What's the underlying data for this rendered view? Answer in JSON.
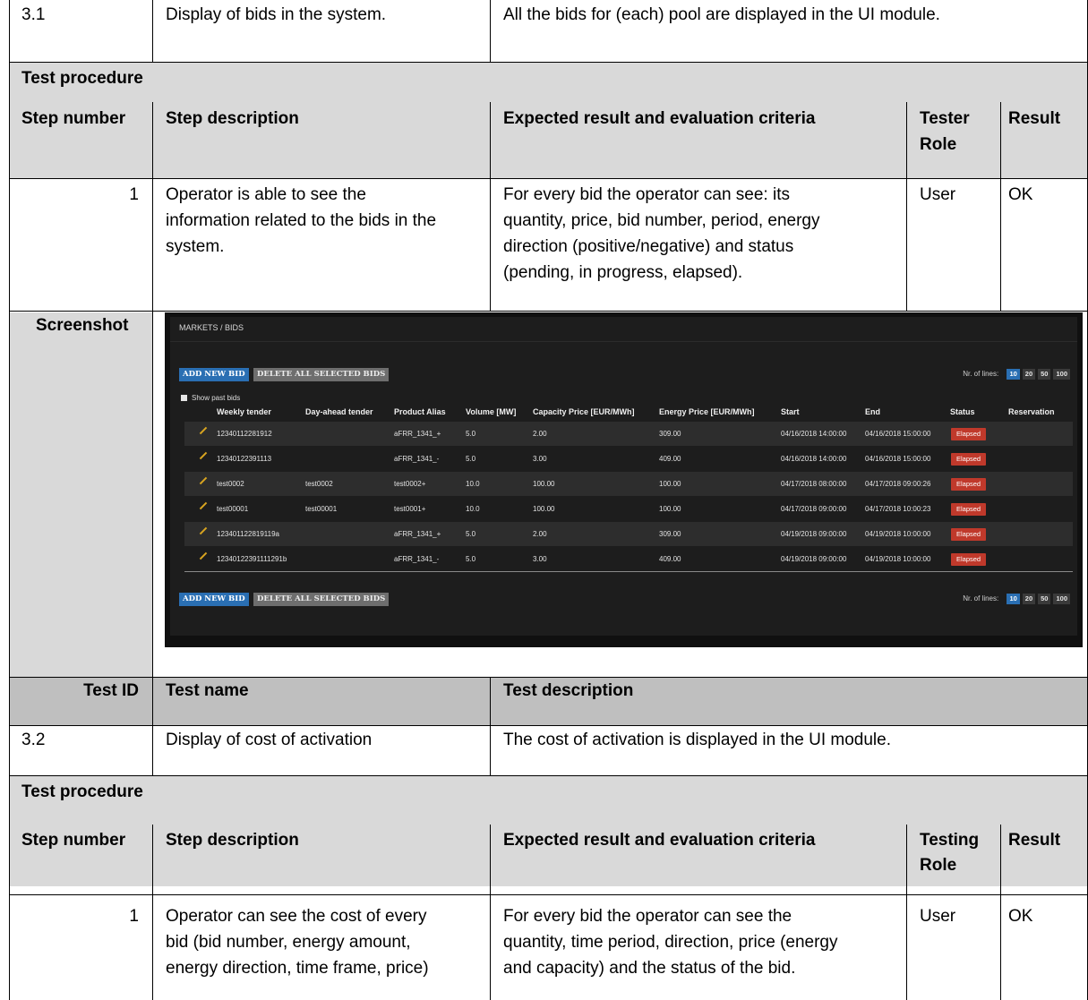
{
  "test_3_1": {
    "id": "3.1",
    "name": "Display of bids in the system.",
    "description": "All the bids for (each) pool are displayed in the UI module.",
    "procedure_label": "Test procedure",
    "headers": {
      "step_number": "Step number",
      "step_description": "Step description",
      "expected": "Expected result and evaluation criteria",
      "role_line1": "Tester",
      "role_line2": "Role",
      "result": "Result"
    },
    "step": {
      "number": "1",
      "desc": [
        "Operator is able to see the",
        "information related to the bids in the",
        "system."
      ],
      "expected": [
        "For every bid the operator can see: its",
        "quantity, price, bid number, period, energy",
        "direction (positive/negative) and status",
        "(pending, in progress, elapsed)."
      ],
      "role": "User",
      "result": "OK"
    },
    "screenshot_label": "Screenshot"
  },
  "screenshot": {
    "breadcrumb": "MARKETS / BIDS",
    "add_new_bid": "ADD NEW BID",
    "delete_selected": "DELETE ALL SELECTED BIDS",
    "nr_of_lines_label": "Nr. of lines:",
    "line_options": [
      "10",
      "20",
      "50",
      "100"
    ],
    "show_past_bids": "Show past bids",
    "columns": [
      "Weekly tender",
      "Day-ahead tender",
      "Product Alias",
      "Volume [MW]",
      "Capacity Price [EUR/MWh]",
      "Energy Price [EUR/MWh]",
      "Start",
      "End",
      "Status",
      "Reservation"
    ],
    "rows": [
      {
        "weekly": "12340112281912",
        "dayahead": "",
        "alias": "aFRR_1341_+",
        "volume": "5.0",
        "capacity": "2.00",
        "energy": "309.00",
        "start": "04/16/2018 14:00:00",
        "end": "04/16/2018 15:00:00",
        "status": "Elapsed"
      },
      {
        "weekly": "12340122391113",
        "dayahead": "",
        "alias": "aFRR_1341_-",
        "volume": "5.0",
        "capacity": "3.00",
        "energy": "409.00",
        "start": "04/16/2018 14:00:00",
        "end": "04/16/2018 15:00:00",
        "status": "Elapsed"
      },
      {
        "weekly": "test0002",
        "dayahead": "test0002",
        "alias": "test0002+",
        "volume": "10.0",
        "capacity": "100.00",
        "energy": "100.00",
        "start": "04/17/2018 08:00:00",
        "end": "04/17/2018 09:00:26",
        "status": "Elapsed"
      },
      {
        "weekly": "test00001",
        "dayahead": "test00001",
        "alias": "test0001+",
        "volume": "10.0",
        "capacity": "100.00",
        "energy": "100.00",
        "start": "04/17/2018 09:00:00",
        "end": "04/17/2018 10:00:23",
        "status": "Elapsed"
      },
      {
        "weekly": "123401122819119a",
        "dayahead": "",
        "alias": "aFRR_1341_+",
        "volume": "5.0",
        "capacity": "2.00",
        "energy": "309.00",
        "start": "04/19/2018 09:00:00",
        "end": "04/19/2018 10:00:00",
        "status": "Elapsed"
      },
      {
        "weekly": "12340122391111291b",
        "dayahead": "",
        "alias": "aFRR_1341_-",
        "volume": "5.0",
        "capacity": "3.00",
        "energy": "409.00",
        "start": "04/19/2018 09:00:00",
        "end": "04/19/2018 10:00:00",
        "status": "Elapsed"
      }
    ]
  },
  "test_3_2_header": {
    "id_label": "Test ID",
    "name_label": "Test name",
    "description_label": "Test description"
  },
  "test_3_2": {
    "id": "3.2",
    "name": "Display of cost of activation",
    "description": "The cost of activation is displayed in the UI module.",
    "procedure_label": "Test procedure",
    "headers": {
      "step_number": "Step number",
      "step_description": "Step description",
      "expected": "Expected result and evaluation criteria",
      "role_line1": "Testing",
      "role_line2": "Role",
      "result": "Result"
    },
    "step": {
      "number": "1",
      "desc": [
        "Operator can see the cost of every",
        "bid (bid number, energy amount,",
        "energy direction, time frame, price)"
      ],
      "expected": [
        "For every bid the operator can see the",
        "quantity, time period, direction, price (energy",
        "and capacity) and the status of the bid."
      ],
      "role": "User",
      "result": "OK"
    }
  },
  "colors": {
    "row_shade": "#d9d9d9",
    "header_shade": "#bfbfbf",
    "elapsed_badge": "#c0392b",
    "primary_button": "#2a6fb3"
  }
}
